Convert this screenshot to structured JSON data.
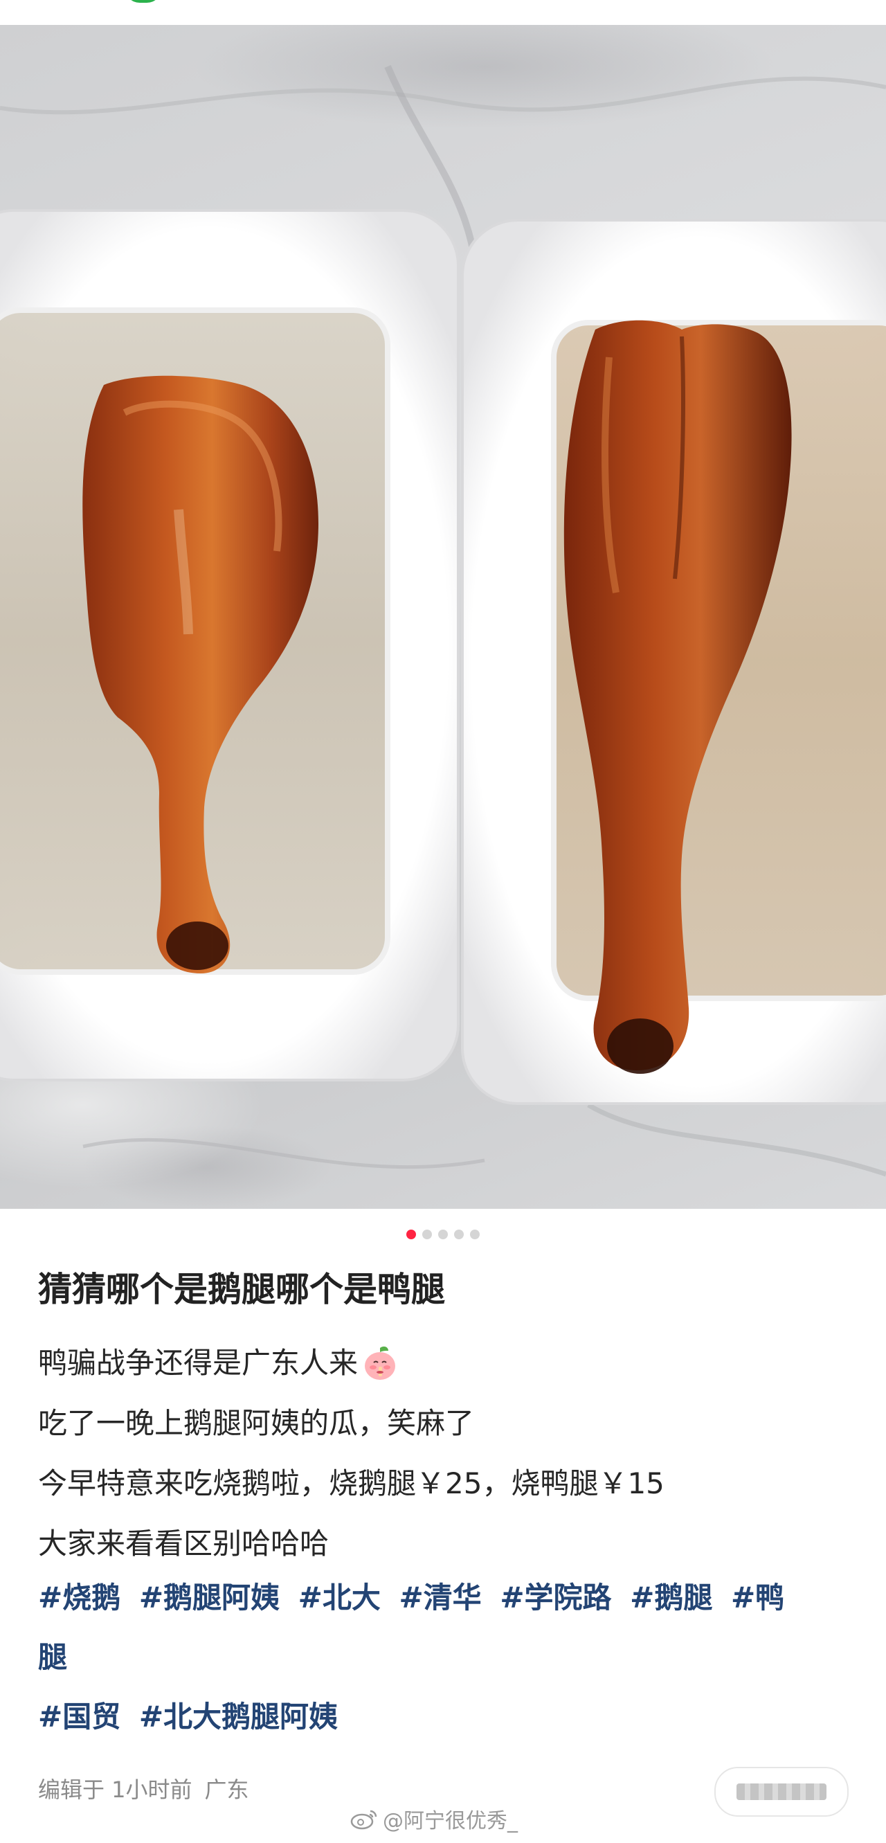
{
  "post": {
    "image_indicator": {
      "total": 5,
      "active": 1
    },
    "title": "猜猜哪个是鹅腿哪个是鸭腿",
    "lines": [
      "鸭骗战争还得是广东人来",
      "吃了一晚上鹅腿阿姨的瓜，笑麻了",
      "今早特意来吃烧鹅啦，烧鹅腿￥25，烧鸭腿￥15",
      "大家来看看区别哈哈哈"
    ],
    "tag_rows": [
      [
        "#烧鹅",
        "#鹅腿阿姨",
        "#北大",
        "#清华",
        "#学院路",
        "#鹅腿",
        "#鸭"
      ],
      [
        "腿"
      ],
      [
        "#国贸",
        "#北大鹅腿阿姨"
      ]
    ],
    "edited": "编辑于 1小时前",
    "location": "广东"
  },
  "watermark": "@阿宁很优秀_",
  "icons": {
    "emoji": "peach-shush-icon",
    "watermark": "weibo-icon"
  },
  "colors": {
    "accent": "#ff2442",
    "tag": "#234474",
    "meta": "#8a8a8a"
  }
}
